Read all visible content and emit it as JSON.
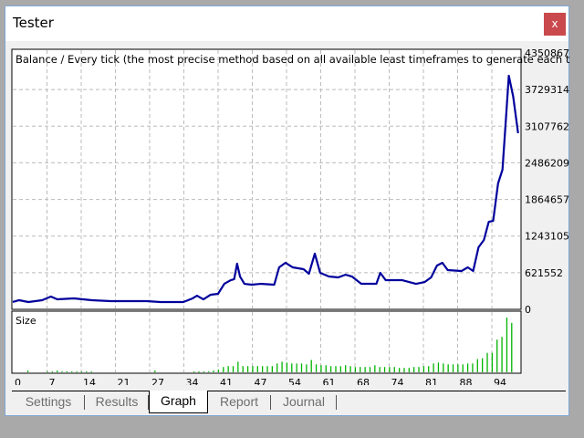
{
  "window": {
    "title": "Tester",
    "close_label": "x"
  },
  "tabs": [
    {
      "label": "Settings"
    },
    {
      "label": "Results"
    },
    {
      "label": "Graph",
      "active": true
    },
    {
      "label": "Report"
    },
    {
      "label": "Journal"
    }
  ],
  "chart_data": {
    "type": "line",
    "title": "Balance / Every tick (the most precise method based on all available least timeframes to generate each tick",
    "ylim": [
      0,
      4350867
    ],
    "y_ticks": [
      "4350867",
      "3729314",
      "3107762",
      "2486209",
      "1864657",
      "1243105",
      "621552",
      "0"
    ],
    "x_ticks": [
      "0",
      "7",
      "14",
      "21",
      "27",
      "34",
      "41",
      "47",
      "54",
      "61",
      "68",
      "74",
      "81",
      "88",
      "94"
    ],
    "xlim": [
      0,
      104
    ],
    "grid": true,
    "colors": {
      "balance": "#00009c",
      "size": "#00b400"
    },
    "balance": [
      [
        0,
        124000
      ],
      [
        1.3,
        155000
      ],
      [
        3.2,
        124000
      ],
      [
        6,
        155000
      ],
      [
        7.8,
        217000
      ],
      [
        9.1,
        170000
      ],
      [
        12.5,
        186000
      ],
      [
        16.2,
        155000
      ],
      [
        20,
        139000
      ],
      [
        23.7,
        139000
      ],
      [
        27.4,
        139000
      ],
      [
        30.2,
        124000
      ],
      [
        34.9,
        124000
      ],
      [
        36.8,
        186000
      ],
      [
        37.7,
        232000
      ],
      [
        39,
        170000
      ],
      [
        40.5,
        248000
      ],
      [
        42,
        263000
      ],
      [
        43.3,
        434000
      ],
      [
        44.6,
        495000
      ],
      [
        45.3,
        511000
      ],
      [
        45.9,
        774000
      ],
      [
        46.5,
        557000
      ],
      [
        47.4,
        433000
      ],
      [
        48.9,
        418000
      ],
      [
        50.7,
        433000
      ],
      [
        53.5,
        418000
      ],
      [
        54.5,
        712000
      ],
      [
        55.8,
        790000
      ],
      [
        57.3,
        712000
      ],
      [
        59.5,
        681000
      ],
      [
        60.6,
        604000
      ],
      [
        61.8,
        945000
      ],
      [
        62.9,
        619000
      ],
      [
        64.7,
        557000
      ],
      [
        66.6,
        542000
      ],
      [
        68.1,
        588000
      ],
      [
        69.4,
        557000
      ],
      [
        71.3,
        433000
      ],
      [
        73.1,
        433000
      ],
      [
        74.4,
        433000
      ],
      [
        75.2,
        619000
      ],
      [
        76.3,
        495000
      ],
      [
        79.7,
        495000
      ],
      [
        82.5,
        433000
      ],
      [
        84.3,
        464000
      ],
      [
        85.6,
        542000
      ],
      [
        86.8,
        743000
      ],
      [
        87.9,
        790000
      ],
      [
        89,
        666000
      ],
      [
        91.8,
        650000
      ],
      [
        93.1,
        712000
      ],
      [
        94.2,
        650000
      ],
      [
        95.3,
        1053000
      ],
      [
        96.4,
        1177000
      ],
      [
        97.4,
        1486000
      ],
      [
        98.3,
        1502000
      ],
      [
        99.3,
        2137000
      ],
      [
        100.2,
        2369000
      ],
      [
        100.9,
        3221000
      ],
      [
        101.5,
        3964000
      ],
      [
        102.4,
        3608000
      ],
      [
        103.4,
        2989000
      ]
    ],
    "size_label": "Size",
    "size": [
      0,
      0,
      0,
      2,
      0,
      0,
      0,
      1,
      1,
      2,
      1,
      1,
      1,
      1,
      1,
      1,
      1,
      0,
      0,
      0,
      0,
      0,
      0,
      0,
      0,
      0,
      0,
      0,
      0,
      2,
      0,
      0,
      0,
      0,
      0,
      0,
      0,
      1,
      1,
      1,
      1,
      2,
      3,
      6,
      7,
      7,
      12,
      7,
      7,
      7,
      7,
      7,
      7,
      7,
      10,
      12,
      11,
      10,
      10,
      10,
      9,
      14,
      9,
      8,
      8,
      7,
      7,
      7,
      8,
      7,
      6,
      6,
      6,
      6,
      8,
      6,
      6,
      6,
      6,
      5,
      5,
      5,
      6,
      6,
      7,
      7,
      10,
      11,
      10,
      9,
      9,
      9,
      9,
      10,
      10,
      15,
      16,
      22,
      22,
      37,
      40,
      62,
      56
    ]
  }
}
